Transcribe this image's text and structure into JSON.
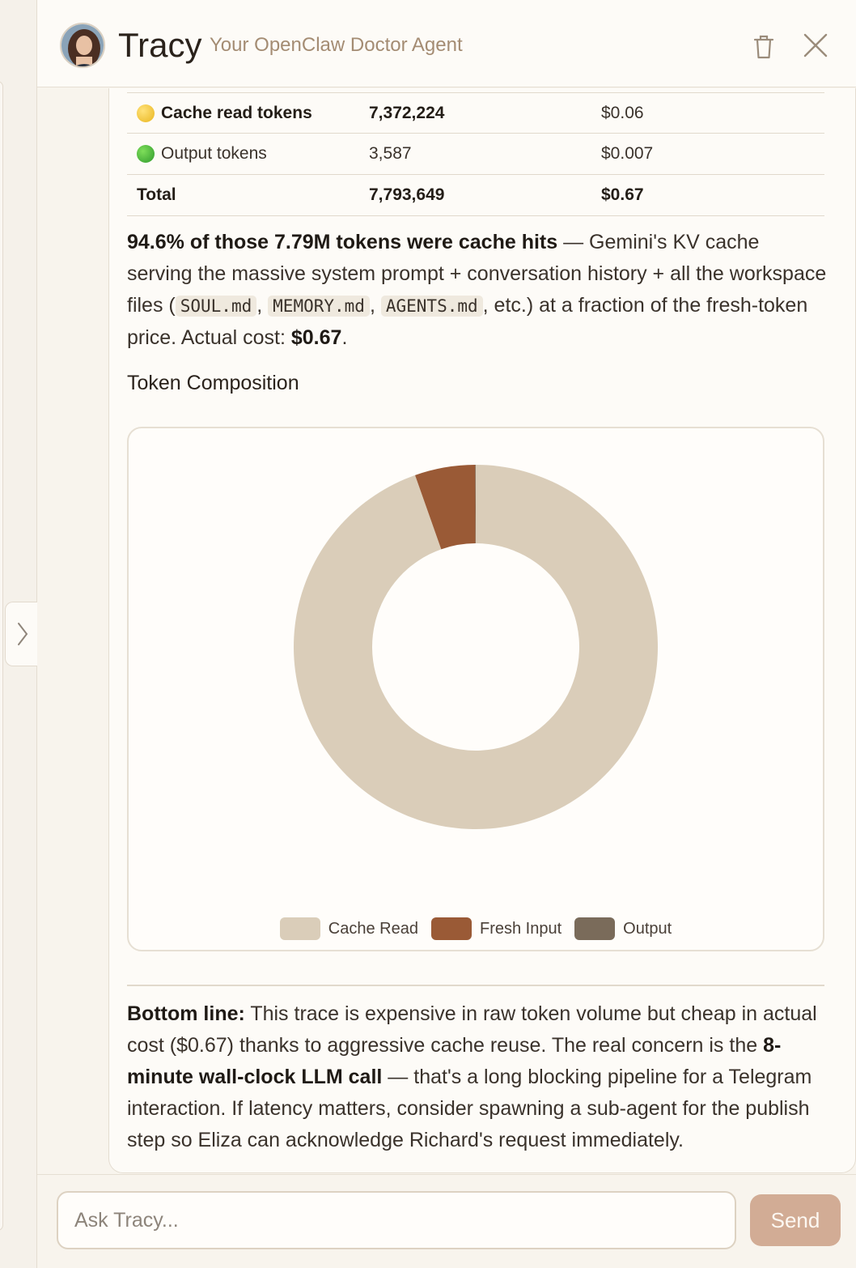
{
  "header": {
    "agent_name": "Tracy",
    "agent_subtitle": "Your OpenClaw Doctor Agent",
    "icons": [
      "avatar",
      "trash-icon",
      "close-icon"
    ]
  },
  "token_table": {
    "rows": [
      {
        "label": "Cache read tokens",
        "tokens": "7,372,224",
        "cost": "$0.06",
        "dot": "yellow",
        "dot_color": "#f2c94c",
        "bold": true
      },
      {
        "label": "Output tokens",
        "tokens": "3,587",
        "cost": "$0.007",
        "dot": "green",
        "dot_color": "#3fae3a",
        "bold": false
      },
      {
        "label": "Total",
        "tokens": "7,793,649",
        "cost": "$0.67",
        "bold": true
      }
    ]
  },
  "summary": {
    "bold_lead": "94.6% of those 7.79M tokens were cache hits",
    "text_1": " — Gemini's KV cache serving the massive system prompt + conversation history + all the workspace files (",
    "code_1": "SOUL.md",
    "sep_1": ", ",
    "code_2": "MEMORY.md",
    "sep_2": ", ",
    "code_3": "AGENTS.md",
    "text_2": ", etc.) at a fraction of the fresh-token price. Actual cost: ",
    "cost_bold": "$0.67",
    "text_3": "."
  },
  "chart_title": "Token Composition",
  "chart_data": {
    "type": "pie",
    "donut": true,
    "categories": [
      "Cache Read",
      "Fresh Input",
      "Output"
    ],
    "values": [
      7372224,
      417838,
      3587
    ],
    "colors": [
      "#dacdb9",
      "#9a5a36",
      "#7a6b5a"
    ],
    "legend": [
      "Cache Read",
      "Fresh Input",
      "Output"
    ],
    "legend_placement": "bottom"
  },
  "bottom_line": {
    "label": "Bottom line:",
    "text_1": " This trace is expensive in raw token volume but cheap in actual cost ($0.67) thanks to aggressive cache reuse. The real concern is the ",
    "bold_2": "8-minute wall-clock LLM call",
    "text_2": " — that's a long blocking pipeline for a Telegram interaction. If latency matters, consider spawning a sub-agent for the publish step so Eliza can acknowledge Richard's request immediately."
  },
  "footer": {
    "input_placeholder": "Ask Tracy...",
    "send_label": "Send"
  },
  "colors": {
    "accent": "#d2ac95",
    "background": "#f8f4ed",
    "cache_read": "#dacdb9",
    "fresh_input": "#9a5a36",
    "output": "#7a6b5a"
  }
}
